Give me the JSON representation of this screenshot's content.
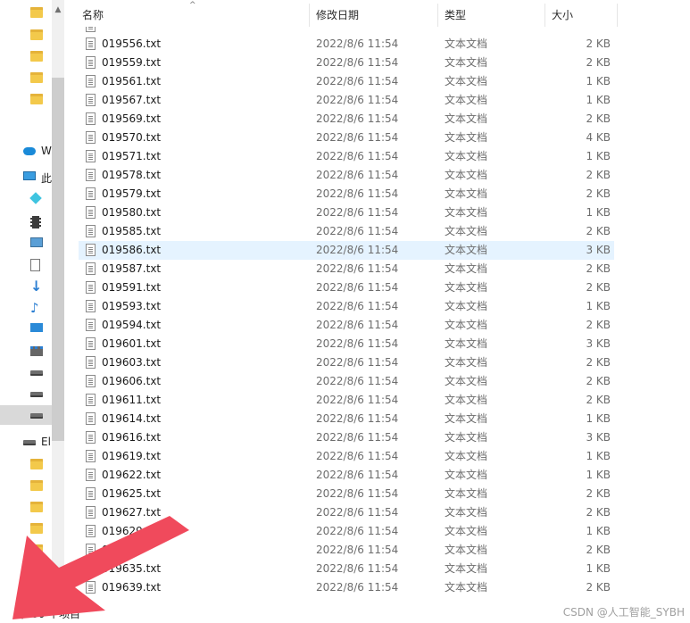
{
  "header": {
    "name_label": "名称",
    "date_label": "修改日期",
    "type_label": "类型",
    "size_label": "大小",
    "sort_icon": "chevron-up-icon"
  },
  "nav": {
    "items": [
      {
        "kind": "folder",
        "label": ""
      },
      {
        "kind": "folder",
        "label": ""
      },
      {
        "kind": "folder",
        "label": ""
      },
      {
        "kind": "folder",
        "label": ""
      },
      {
        "kind": "folder",
        "label": ""
      },
      {
        "kind": "cloud",
        "label": "W"
      },
      {
        "kind": "pc",
        "label": "此"
      },
      {
        "kind": "3d",
        "label": ""
      },
      {
        "kind": "video",
        "label": ""
      },
      {
        "kind": "pictures",
        "label": ""
      },
      {
        "kind": "docs",
        "label": ""
      },
      {
        "kind": "download",
        "label": ""
      },
      {
        "kind": "music",
        "label": ""
      },
      {
        "kind": "desktop",
        "label": ""
      },
      {
        "kind": "network-drive",
        "label": ""
      },
      {
        "kind": "drive",
        "label": ""
      },
      {
        "kind": "drive",
        "label": ""
      },
      {
        "kind": "drive",
        "label": ""
      },
      {
        "kind": "drive",
        "label": "El"
      },
      {
        "kind": "folder",
        "label": ""
      },
      {
        "kind": "folder",
        "label": ""
      },
      {
        "kind": "folder",
        "label": ""
      },
      {
        "kind": "folder",
        "label": ""
      },
      {
        "kind": "folder",
        "label": ""
      },
      {
        "kind": "folder",
        "label": ""
      },
      {
        "kind": "folder",
        "label": ""
      }
    ]
  },
  "files": [
    {
      "name": "019556.txt",
      "date": "2022/8/6 11:54",
      "type": "文本文档",
      "size": "2 KB"
    },
    {
      "name": "019559.txt",
      "date": "2022/8/6 11:54",
      "type": "文本文档",
      "size": "2 KB"
    },
    {
      "name": "019561.txt",
      "date": "2022/8/6 11:54",
      "type": "文本文档",
      "size": "1 KB"
    },
    {
      "name": "019567.txt",
      "date": "2022/8/6 11:54",
      "type": "文本文档",
      "size": "1 KB"
    },
    {
      "name": "019569.txt",
      "date": "2022/8/6 11:54",
      "type": "文本文档",
      "size": "2 KB"
    },
    {
      "name": "019570.txt",
      "date": "2022/8/6 11:54",
      "type": "文本文档",
      "size": "4 KB"
    },
    {
      "name": "019571.txt",
      "date": "2022/8/6 11:54",
      "type": "文本文档",
      "size": "1 KB"
    },
    {
      "name": "019578.txt",
      "date": "2022/8/6 11:54",
      "type": "文本文档",
      "size": "2 KB"
    },
    {
      "name": "019579.txt",
      "date": "2022/8/6 11:54",
      "type": "文本文档",
      "size": "2 KB"
    },
    {
      "name": "019580.txt",
      "date": "2022/8/6 11:54",
      "type": "文本文档",
      "size": "1 KB"
    },
    {
      "name": "019585.txt",
      "date": "2022/8/6 11:54",
      "type": "文本文档",
      "size": "2 KB"
    },
    {
      "name": "019586.txt",
      "date": "2022/8/6 11:54",
      "type": "文本文档",
      "size": "3 KB"
    },
    {
      "name": "019587.txt",
      "date": "2022/8/6 11:54",
      "type": "文本文档",
      "size": "2 KB"
    },
    {
      "name": "019591.txt",
      "date": "2022/8/6 11:54",
      "type": "文本文档",
      "size": "2 KB"
    },
    {
      "name": "019593.txt",
      "date": "2022/8/6 11:54",
      "type": "文本文档",
      "size": "1 KB"
    },
    {
      "name": "019594.txt",
      "date": "2022/8/6 11:54",
      "type": "文本文档",
      "size": "2 KB"
    },
    {
      "name": "019601.txt",
      "date": "2022/8/6 11:54",
      "type": "文本文档",
      "size": "3 KB"
    },
    {
      "name": "019603.txt",
      "date": "2022/8/6 11:54",
      "type": "文本文档",
      "size": "2 KB"
    },
    {
      "name": "019606.txt",
      "date": "2022/8/6 11:54",
      "type": "文本文档",
      "size": "2 KB"
    },
    {
      "name": "019611.txt",
      "date": "2022/8/6 11:54",
      "type": "文本文档",
      "size": "2 KB"
    },
    {
      "name": "019614.txt",
      "date": "2022/8/6 11:54",
      "type": "文本文档",
      "size": "1 KB"
    },
    {
      "name": "019616.txt",
      "date": "2022/8/6 11:54",
      "type": "文本文档",
      "size": "3 KB"
    },
    {
      "name": "019619.txt",
      "date": "2022/8/6 11:54",
      "type": "文本文档",
      "size": "1 KB"
    },
    {
      "name": "019622.txt",
      "date": "2022/8/6 11:54",
      "type": "文本文档",
      "size": "1 KB"
    },
    {
      "name": "019625.txt",
      "date": "2022/8/6 11:54",
      "type": "文本文档",
      "size": "2 KB"
    },
    {
      "name": "019627.txt",
      "date": "2022/8/6 11:54",
      "type": "文本文档",
      "size": "2 KB"
    },
    {
      "name": "019629.txt",
      "date": "2022/8/6 11:54",
      "type": "文本文档",
      "size": "1 KB"
    },
    {
      "name": "01963",
      "date": "2022/8/6 11:54",
      "type": "文本文档",
      "size": "2 KB"
    },
    {
      "name": "019635.txt",
      "date": "2022/8/6 11:54",
      "type": "文本文档",
      "size": "1 KB"
    },
    {
      "name": "019639.txt",
      "date": "2022/8/6 11:54",
      "type": "文本文档",
      "size": "2 KB"
    }
  ],
  "status": {
    "item_count": "7,200 个项目"
  },
  "watermark": "CSDN @人工智能_SYBH",
  "colors": {
    "hover_row": "#e5f3ff",
    "arrow": "#f04a5c",
    "folder": "#f3c94b"
  }
}
